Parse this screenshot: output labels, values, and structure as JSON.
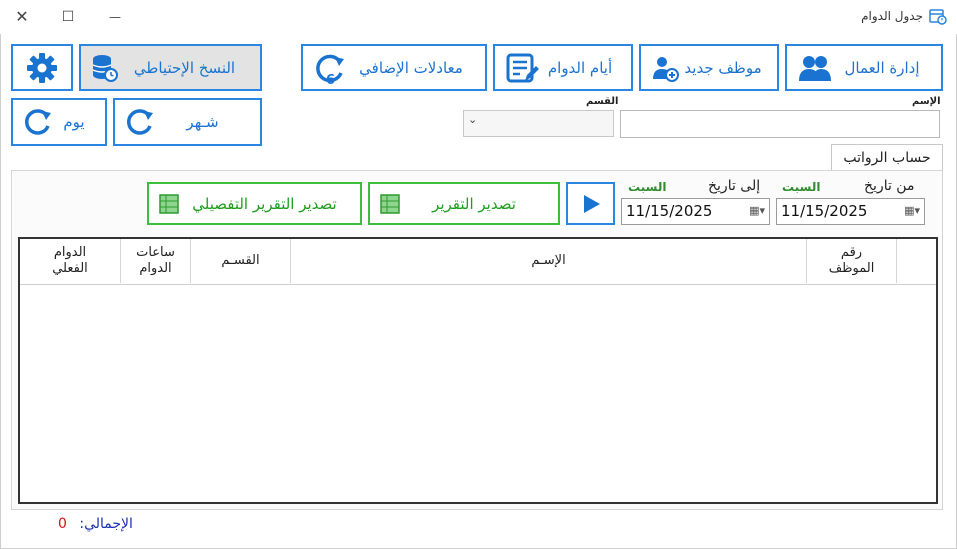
{
  "window": {
    "title": "جدول الدوام",
    "controls": {
      "minimize": "—",
      "maximize": "☐",
      "close": "✕"
    }
  },
  "toolbar": {
    "settings_icon": "gear-icon",
    "backup_label": "النسخ الإحتياطي",
    "overtime_label": "معادلات الإضافي",
    "work_days_label": "أيام الدوام",
    "new_employee_label": "موظف جديد",
    "workers_label": "إدارة العمال",
    "day_label": "يوم",
    "month_label": "شـهر"
  },
  "filters": {
    "name_label": "الإسم",
    "name_value": "",
    "department_label": "القسم",
    "department_value": ""
  },
  "tabs": [
    {
      "label": "حساب الرواتب"
    }
  ],
  "report": {
    "from_label": "من تاريخ",
    "to_label": "إلى تاريخ",
    "from_day": "السبت",
    "to_day": "السبت",
    "from_date": "11/15/2025",
    "to_date": "11/15/2025",
    "export_label": "تصدير التقرير",
    "export_detailed_label": "تصدير التقرير التفصيلي"
  },
  "grid": {
    "columns": {
      "employee_no_l1": "رقم",
      "employee_no_l2": "الموظف",
      "name": "الإسـم",
      "department": "القسـم",
      "hours_l1": "ساعات",
      "hours_l2": "الدوام",
      "actual_l1": "الدوام",
      "actual_l2": "الفعلي"
    },
    "rows": []
  },
  "footer": {
    "total_label": "الإجمالي:",
    "total_value": "0"
  },
  "colors": {
    "accent": "#2a86e0",
    "green": "#3cbf3c",
    "day_green": "#2e8b2e",
    "total_red": "#d01515",
    "total_blue": "#1a2fb0"
  }
}
